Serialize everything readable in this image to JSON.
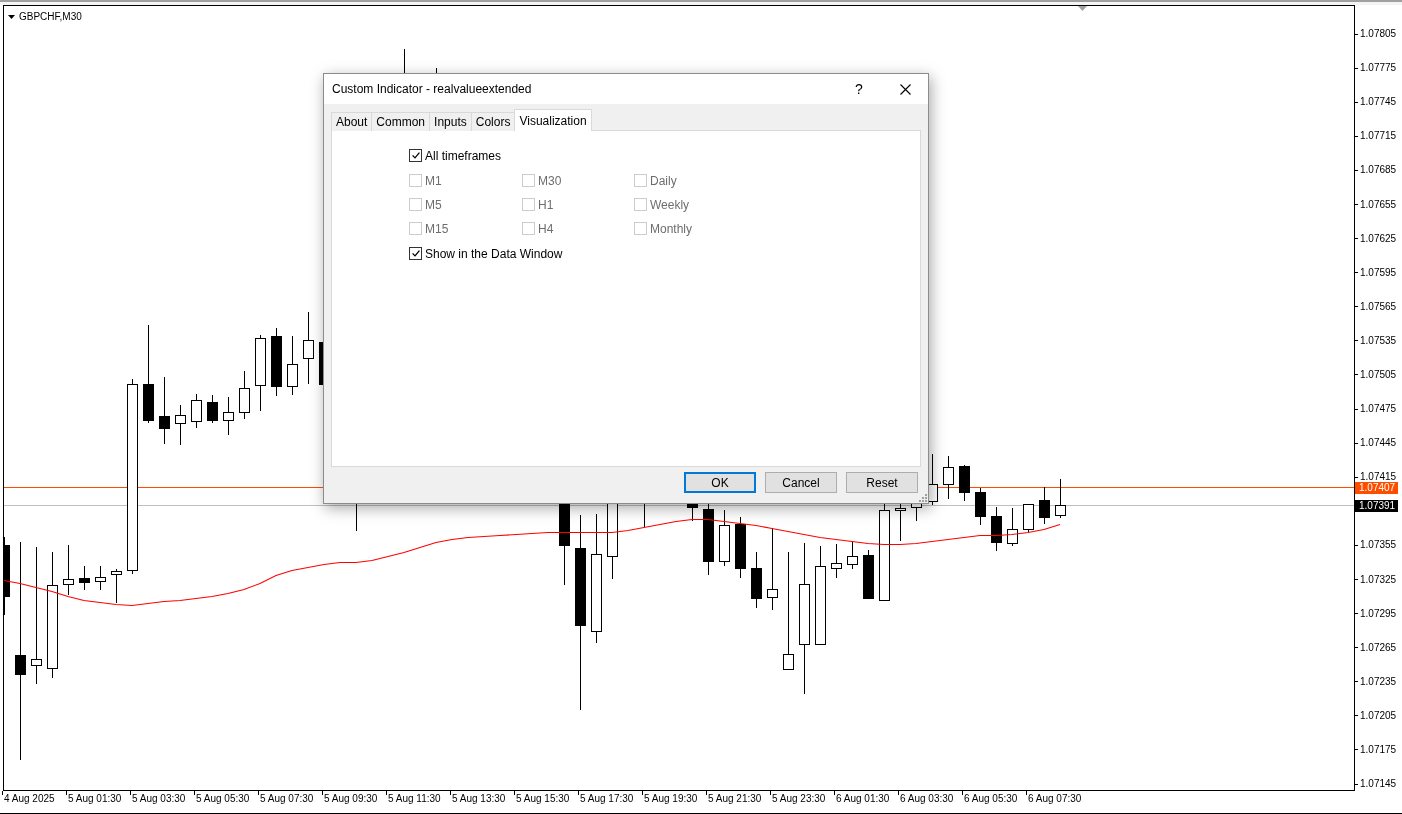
{
  "chart": {
    "symbol": "GBPCHF,M30",
    "price_labels": [
      "1.07805",
      "1.07775",
      "1.07745",
      "1.07715",
      "1.07685",
      "1.07655",
      "1.07625",
      "1.07595",
      "1.07565",
      "1.07535",
      "1.07505",
      "1.07475",
      "1.07445",
      "1.07415",
      "1.07355",
      "1.07325",
      "1.07295",
      "1.07265",
      "1.07235",
      "1.07205",
      "1.07175",
      "1.07145"
    ],
    "bid_price": "1.07407",
    "ask_price": "1.07391",
    "time_labels": [
      "4 Aug 2025",
      "5 Aug 01:30",
      "5 Aug 03:30",
      "5 Aug 05:30",
      "5 Aug 07:30",
      "5 Aug 09:30",
      "5 Aug 11:30",
      "5 Aug 13:30",
      "5 Aug 15:30",
      "5 Aug 17:30",
      "5 Aug 19:30",
      "5 Aug 21:30",
      "5 Aug 23:30",
      "6 Aug 01:30",
      "6 Aug 03:30",
      "6 Aug 05:30",
      "6 Aug 07:30"
    ]
  },
  "dialog": {
    "title": "Custom Indicator - realvalueextended",
    "help": "?",
    "tabs": [
      {
        "label": "About",
        "selected": false
      },
      {
        "label": "Common",
        "selected": false
      },
      {
        "label": "Inputs",
        "selected": false
      },
      {
        "label": "Colors",
        "selected": false
      },
      {
        "label": "Visualization",
        "selected": true
      }
    ],
    "all_timeframes": {
      "label": "All timeframes",
      "checked": true
    },
    "timeframes": [
      {
        "label": "M1",
        "checked": false,
        "disabled": true
      },
      {
        "label": "M30",
        "checked": false,
        "disabled": true
      },
      {
        "label": "Daily",
        "checked": false,
        "disabled": true
      },
      {
        "label": "M5",
        "checked": false,
        "disabled": true
      },
      {
        "label": "H1",
        "checked": false,
        "disabled": true
      },
      {
        "label": "Weekly",
        "checked": false,
        "disabled": true
      },
      {
        "label": "M15",
        "checked": false,
        "disabled": true
      },
      {
        "label": "H4",
        "checked": false,
        "disabled": true
      },
      {
        "label": "Monthly",
        "checked": false,
        "disabled": true
      }
    ],
    "show_in_data_window": {
      "label": "Show in the Data Window",
      "checked": true
    },
    "buttons": [
      {
        "label": "OK",
        "default": true
      },
      {
        "label": "Cancel",
        "default": false
      },
      {
        "label": "Reset",
        "default": false
      }
    ]
  }
}
